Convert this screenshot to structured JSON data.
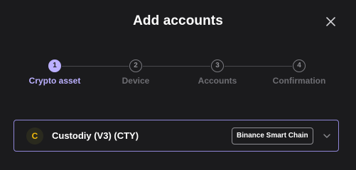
{
  "dialog": {
    "title": "Add accounts",
    "close_icon": "close-icon"
  },
  "stepper": {
    "steps": [
      {
        "number": "1",
        "label": "Crypto asset",
        "active": true
      },
      {
        "number": "2",
        "label": "Device",
        "active": false
      },
      {
        "number": "3",
        "label": "Accounts",
        "active": false
      },
      {
        "number": "4",
        "label": "Confirmation",
        "active": false
      }
    ],
    "colors": {
      "active": "#bbb0ff",
      "inactive": "#6e6e73"
    }
  },
  "selected_asset": {
    "icon_letter": "C",
    "icon_color": "#f0b90b",
    "name": "Custodiy (V3) (CTY)",
    "network": "Binance Smart Chain",
    "dropdown_icon": "chevron-down-icon"
  }
}
